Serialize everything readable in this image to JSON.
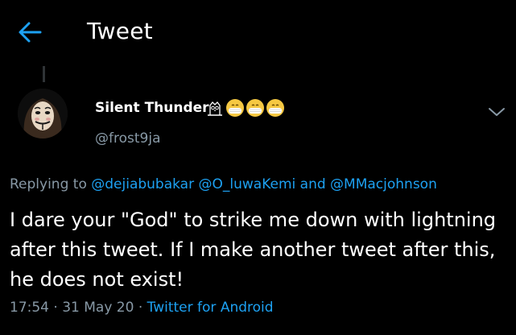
{
  "header": {
    "title": "Tweet",
    "back_icon": "back-arrow-icon"
  },
  "tweet": {
    "author": {
      "name": "Silent Thunder",
      "handle": "@frost9ja",
      "name_emojis": [
        "owl-icon",
        "face-with-medical-mask-emoji",
        "face-with-medical-mask-emoji",
        "face-with-medical-mask-emoji"
      ],
      "avatar_icon": "guy-fawkes-mask-avatar"
    },
    "replying_to_label": "Replying to",
    "replying_to": [
      "@dejiabubakar",
      "@O_luwaKemi",
      "@MMacjohnson"
    ],
    "replying_and": "and",
    "text": "I dare your \"God\" to strike me down with lightning after this tweet. If I make another tweet after this, he does not exist!",
    "time": "17:54",
    "separator": "·",
    "date": "31 May 20",
    "source": "Twitter for Android",
    "menu_icon": "chevron-down-icon"
  },
  "colors": {
    "background": "#000000",
    "primary_text": "#ffffff",
    "secondary_text": "#8899a6",
    "accent": "#1da1f2"
  }
}
